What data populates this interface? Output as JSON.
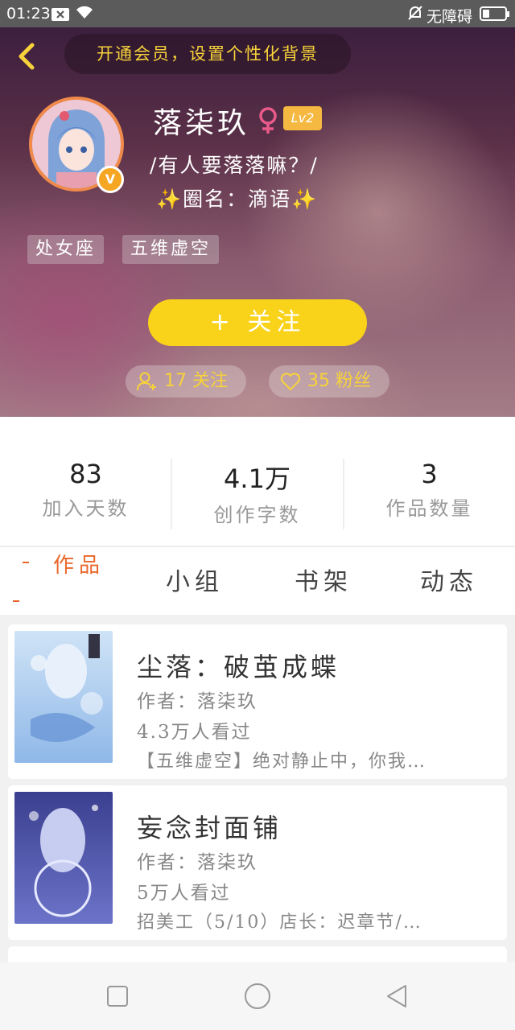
{
  "status_bar": {
    "time": "01:23",
    "right_text": "无障碍"
  },
  "header": {
    "vip_banner": "开通会员，设置个性化背景",
    "username": "落柒玖",
    "level": "Lv2",
    "bio_line1": "/有人要落落嘛？/",
    "bio_line2_prefix": "✨",
    "bio_line2_text": "圈名：滴语",
    "bio_line2_suffix": "✨",
    "tags": [
      "处女座",
      "五维虚空"
    ],
    "follow_button": "+ 关注",
    "following": "17 关注",
    "fans": "35 粉丝"
  },
  "stats": [
    {
      "value": "83",
      "label": "加入天数"
    },
    {
      "value": "4.1万",
      "label": "创作字数"
    },
    {
      "value": "3",
      "label": "作品数量"
    }
  ],
  "tabs": [
    "作品",
    "小组",
    "书架",
    "动态"
  ],
  "books": [
    {
      "title": "尘落：破茧成蝶",
      "author": "作者：落柒玖",
      "views": "4.3万人看过",
      "desc": "【五维虚空】绝对静止中，你我…"
    },
    {
      "title": "妄念封面铺",
      "author": "作者：落柒玖",
      "views": "5万人看过",
      "desc": "招美工（5/10）店长：迟章节/…"
    }
  ],
  "colors": {
    "accent": "#f9d21a",
    "active_tab": "#e9672a",
    "avatar_ring": "#f08a4a"
  }
}
